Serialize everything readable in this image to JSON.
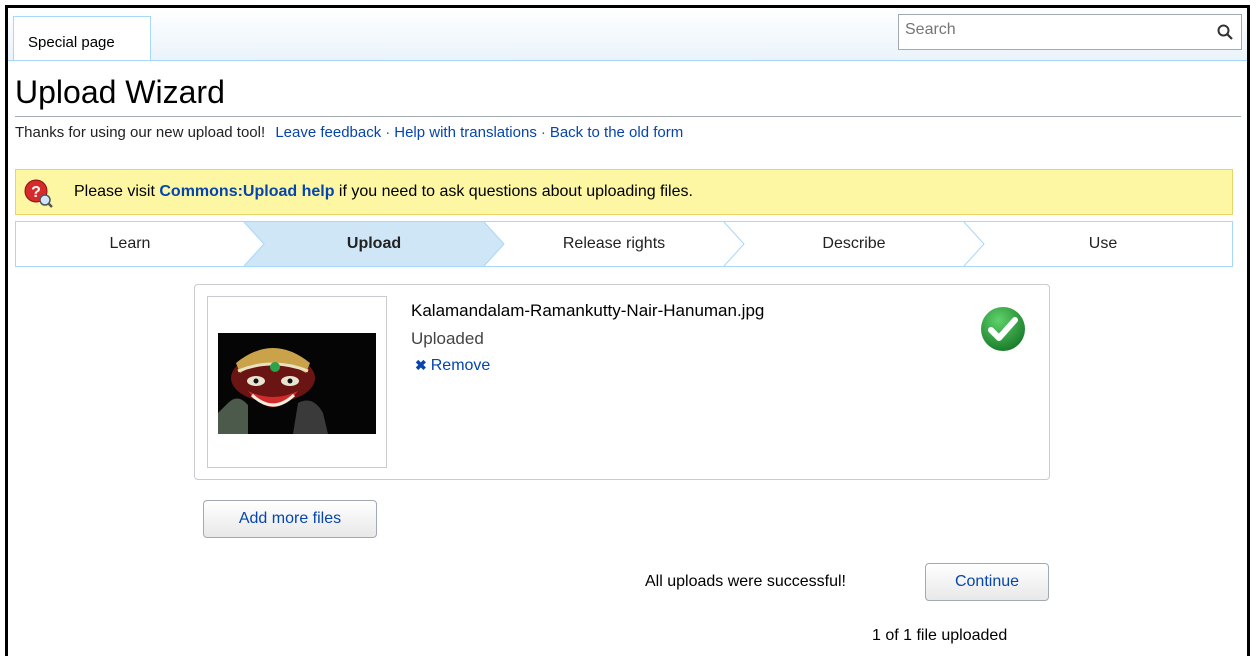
{
  "tab": {
    "label": "Special page"
  },
  "search": {
    "placeholder": "Search"
  },
  "page": {
    "title": "Upload Wizard",
    "intro": "Thanks for using our new upload tool!",
    "links": [
      "Leave feedback",
      "Help with translations",
      "Back to the old form"
    ],
    "separator": "·"
  },
  "notice": {
    "prefix": "Please visit ",
    "link": "Commons:Upload help",
    "suffix": " if you need to ask questions about uploading files."
  },
  "steps": [
    {
      "label": "Learn",
      "active": false
    },
    {
      "label": "Upload",
      "active": true
    },
    {
      "label": "Release rights",
      "active": false
    },
    {
      "label": "Describe",
      "active": false
    },
    {
      "label": "Use",
      "active": false
    }
  ],
  "file": {
    "name": "Kalamandalam-Ramankutty-Nair-Hanuman.jpg",
    "status": "Uploaded",
    "remove_label": "Remove",
    "remove_icon": "x-icon",
    "status_icon": "green-checkmark-icon"
  },
  "actions": {
    "add_more": "Add more files",
    "success_message": "All uploads were successful!",
    "continue": "Continue",
    "count": "1 of 1 file uploaded"
  },
  "colors": {
    "link": "#0645ad",
    "notice_bg": "#fdf6a3",
    "active_step_bg": "#cfe6f7",
    "step_border": "#a7d7f9",
    "success_green": "#2e9a3e"
  }
}
